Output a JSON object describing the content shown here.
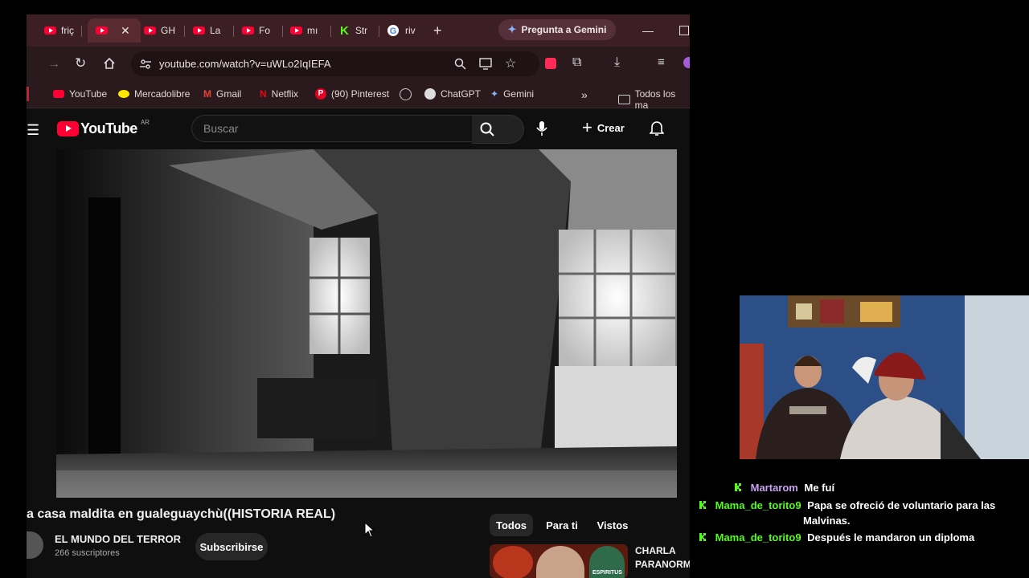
{
  "browser": {
    "tabs": [
      {
        "label": "friç",
        "icon": "youtube-icon"
      },
      {
        "label": "",
        "icon": "youtube-icon",
        "active": true
      },
      {
        "label": "GH",
        "icon": "youtube-icon"
      },
      {
        "label": "La",
        "icon": "youtube-icon"
      },
      {
        "label": "Fo",
        "icon": "youtube-icon"
      },
      {
        "label": "mı",
        "icon": "youtube-icon"
      },
      {
        "label": "Str",
        "icon": "kick-icon"
      },
      {
        "label": "riv",
        "icon": "google-icon"
      }
    ],
    "gemini_button": "Pregunta a Gemini",
    "url": "youtube.com/watch?v=uWLo2IqIEFA",
    "bookmarks": [
      "YouTube",
      "Mercadolibre",
      "Gmail",
      "Netflix",
      "(90) Pinterest",
      "ChatGPT",
      "Gemini"
    ],
    "bookmarks_folder": "Todos los ma"
  },
  "youtube": {
    "logo_text": "YouTube",
    "region": "AR",
    "search_placeholder": "Buscar",
    "create_label": "Crear",
    "video_title": "a casa maldita en gualeguaychù((HISTORIA REAL)",
    "channel_name": "EL MUNDO DEL TERROR",
    "subscribers": "266 suscriptores",
    "subscribe_label": "Subscribirse",
    "chips": [
      "Todos",
      "Para ti",
      "Vistos"
    ],
    "suggested_title_line1": "CHARLA",
    "suggested_title_line2": "PARANORM",
    "thumb_caption": "ESPIRITUS"
  },
  "chat": [
    {
      "user": "Martarom",
      "message": "Me fuí"
    },
    {
      "user": "Mama_de_torito9",
      "message": "Papa se ofreció de voluntario para las",
      "message2": "Malvinas."
    },
    {
      "user": "Mama_de_torito9",
      "message": "Después le mandaron un diploma"
    }
  ],
  "colors": {
    "kick_green": "#53fc18",
    "youtube_red": "#ff0033",
    "chat_user_purple": "#c8a2f0",
    "chat_user_green": "#53fc18"
  }
}
